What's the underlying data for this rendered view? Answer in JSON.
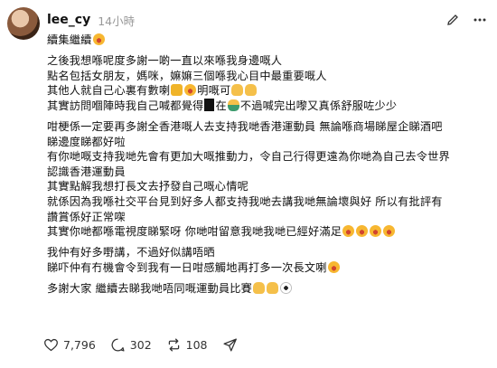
{
  "post": {
    "username": "lee_cy",
    "time": "14小時",
    "lines": [
      "續集繼續",
      "",
      "之後我想喺呢度多謝一啲一直以來喺我身邊嘅人",
      "點名包括女朋友，媽咪，嫲嫲三個喺我心目中最重要嘅人",
      "其他人就自己心裏有數喇",
      "其實訪問嗰陣時我自己喊都覺得",
      "",
      "咁梗係一定要再多謝全香港嘅人去支持我哋香港運動員 無論喺商場睇屋企睇酒吧",
      "睇邊度睇都好啦",
      "有你哋嘅支持我哋先會有更加大嘅推動力，令自己行得更遠為你哋為自己去令世界",
      "認識香港運動員",
      "其實點解我想打長文去抒發自己嘅心情呢",
      "就係因為我喺社交平台見到好多人都支持我哋去講我哋無論壞與好 所以有批評有",
      "讚賞係好正常㗎",
      "其實你哋都喺電視度睇緊呀 你哋咁留意我哋我哋已經好滿足",
      "",
      "我仲有好多嘢講，不過好似講唔晒",
      "睇吓仲有冇機會令到我有一日咁感觸地再打多一次長文喇",
      "",
      "多謝大家 繼續去睇我哋唔同嘅運動員比賽"
    ],
    "line4_tail": "明嘅可",
    "line5_tail": "在",
    "line5_tail2": "不過喊完出嚟又真係舒服咗少少"
  },
  "actions": {
    "likes": "7,796",
    "comments": "302",
    "reposts": "108"
  }
}
